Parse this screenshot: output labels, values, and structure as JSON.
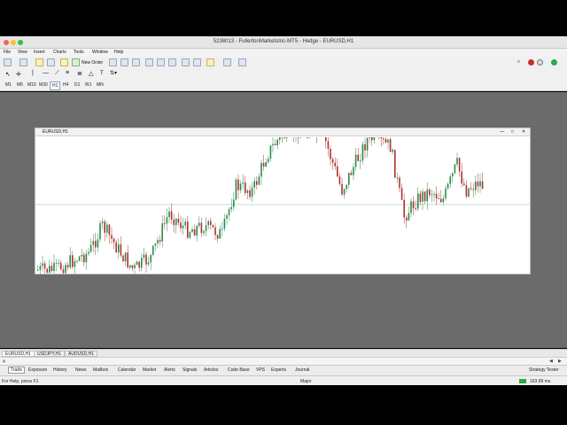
{
  "window": {
    "title": "5238013 - FullertonMarketsInc-MT5 - Hedge - EURUSD,H1"
  },
  "menu": [
    "File",
    "View",
    "Insert",
    "Charts",
    "Tools",
    "Window",
    "Help"
  ],
  "toolbar": {
    "new_order_label": "New Order"
  },
  "timeframes": [
    "M1",
    "M5",
    "M15",
    "M30",
    "H1",
    "H4",
    "D1",
    "W1",
    "MN"
  ],
  "selected_timeframe": "H1",
  "chart": {
    "title": "EURUSD,H1",
    "minimize": "—",
    "restore": "□",
    "close": "✕"
  },
  "chart_tabs": [
    "EURUSD,H1",
    "USDJPY,H1",
    "AUDUSD,H1"
  ],
  "active_chart_tab": "EURUSD,H1",
  "bottom_tabs": [
    "Trade",
    "Exposure",
    "History",
    "News",
    "Mailbox",
    "Calendar",
    "Market",
    "Alerts",
    "Signals",
    "Articles",
    "Code Base",
    "VPS",
    "Experts",
    "Journal"
  ],
  "active_bottom_tab": "Trade",
  "strategy_tester_label": "Strategy Tester",
  "status": {
    "help": "For Help, press F1",
    "profile": "Major",
    "ping": "163.99 ms"
  },
  "colors": {
    "bull": "#2a8a4a",
    "bear": "#b03030",
    "bid_line": "#a8d8c0",
    "workspace": "#6b6b6b"
  }
}
